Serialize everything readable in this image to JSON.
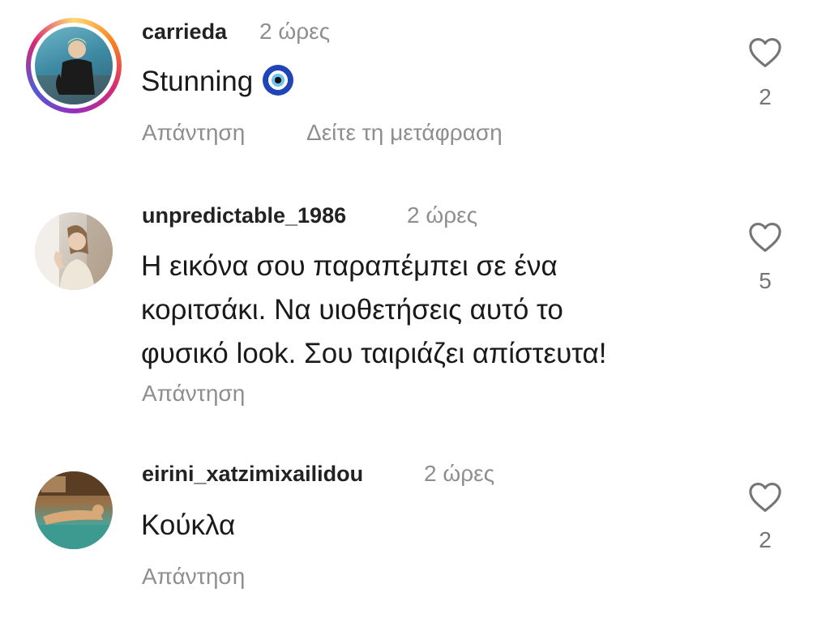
{
  "comments": [
    {
      "username": "carrieda",
      "time": "2 ώρες",
      "text_lines": [
        "Stunning"
      ],
      "emoji_icon": "evil-eye-icon",
      "likes": "2",
      "reply_label": "Απάντηση",
      "translate_label": "Δείτε τη μετάφραση",
      "avatar_has_story_ring": true
    },
    {
      "username": "unpredictable_1986",
      "time": "2 ώρες",
      "text_lines": [
        "Η εικόνα σου παραπέμπει σε ένα",
        "κοριτσάκι. Να υιοθετήσεις αυτό το",
        "φυσικό look. Σου ταιριάζει απίστευτα!"
      ],
      "likes": "5",
      "reply_label": "Απάντηση"
    },
    {
      "username": "eirini_xatzimixailidou",
      "time": "2 ώρες",
      "text_lines": [
        "Κούκλα"
      ],
      "likes": "2",
      "reply_label": "Απάντηση"
    }
  ],
  "colors": {
    "username": "#222222",
    "meta": "#8e8e8e",
    "text": "#1a1a1a",
    "heart_outline": "#757575"
  }
}
